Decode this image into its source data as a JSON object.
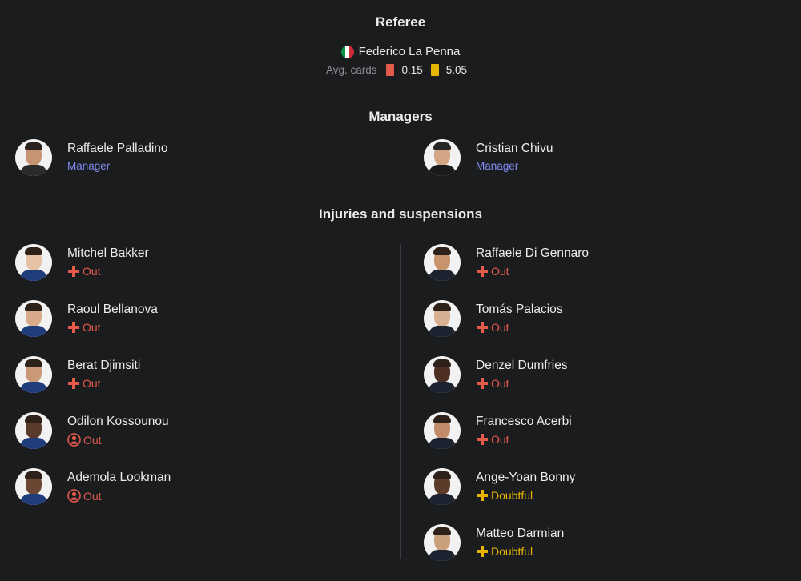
{
  "referee": {
    "section_title": "Referee",
    "name": "Federico La Penna",
    "flag_colors": [
      "#009246",
      "#ffffff",
      "#ce2b37"
    ],
    "avg_cards_label": "Avg. cards",
    "red_avg": "0.15",
    "yellow_avg": "5.05"
  },
  "managers": {
    "section_title": "Managers",
    "home": {
      "name": "Raffaele Palladino",
      "role": "Manager"
    },
    "away": {
      "name": "Cristian Chivu",
      "role": "Manager"
    }
  },
  "injuries": {
    "section_title": "Injuries and suspensions",
    "home": [
      {
        "name": "Mitchel Bakker",
        "status": "Out",
        "icon": "injury-cross-icon"
      },
      {
        "name": "Raoul Bellanova",
        "status": "Out",
        "icon": "injury-cross-icon"
      },
      {
        "name": "Berat Djimsiti",
        "status": "Out",
        "icon": "injury-cross-icon"
      },
      {
        "name": "Odilon Kossounou",
        "status": "Out",
        "icon": "person-absent-icon"
      },
      {
        "name": "Ademola Lookman",
        "status": "Out",
        "icon": "person-absent-icon"
      }
    ],
    "away": [
      {
        "name": "Raffaele Di Gennaro",
        "status": "Out",
        "icon": "injury-cross-icon"
      },
      {
        "name": "Tomás Palacios",
        "status": "Out",
        "icon": "injury-cross-icon"
      },
      {
        "name": "Denzel Dumfries",
        "status": "Out",
        "icon": "injury-cross-icon"
      },
      {
        "name": "Francesco Acerbi",
        "status": "Out",
        "icon": "injury-cross-icon"
      },
      {
        "name": "Ange-Yoan Bonny",
        "status": "Doubtful",
        "icon": "injury-cross-icon"
      },
      {
        "name": "Matteo Darmian",
        "status": "Doubtful",
        "icon": "injury-cross-icon"
      }
    ]
  },
  "colors": {
    "background": "#1b1c1e",
    "out": "#e35a4b",
    "doubtful": "#e7b400",
    "role": "#7f8cf2",
    "muted": "#8e8f93"
  }
}
